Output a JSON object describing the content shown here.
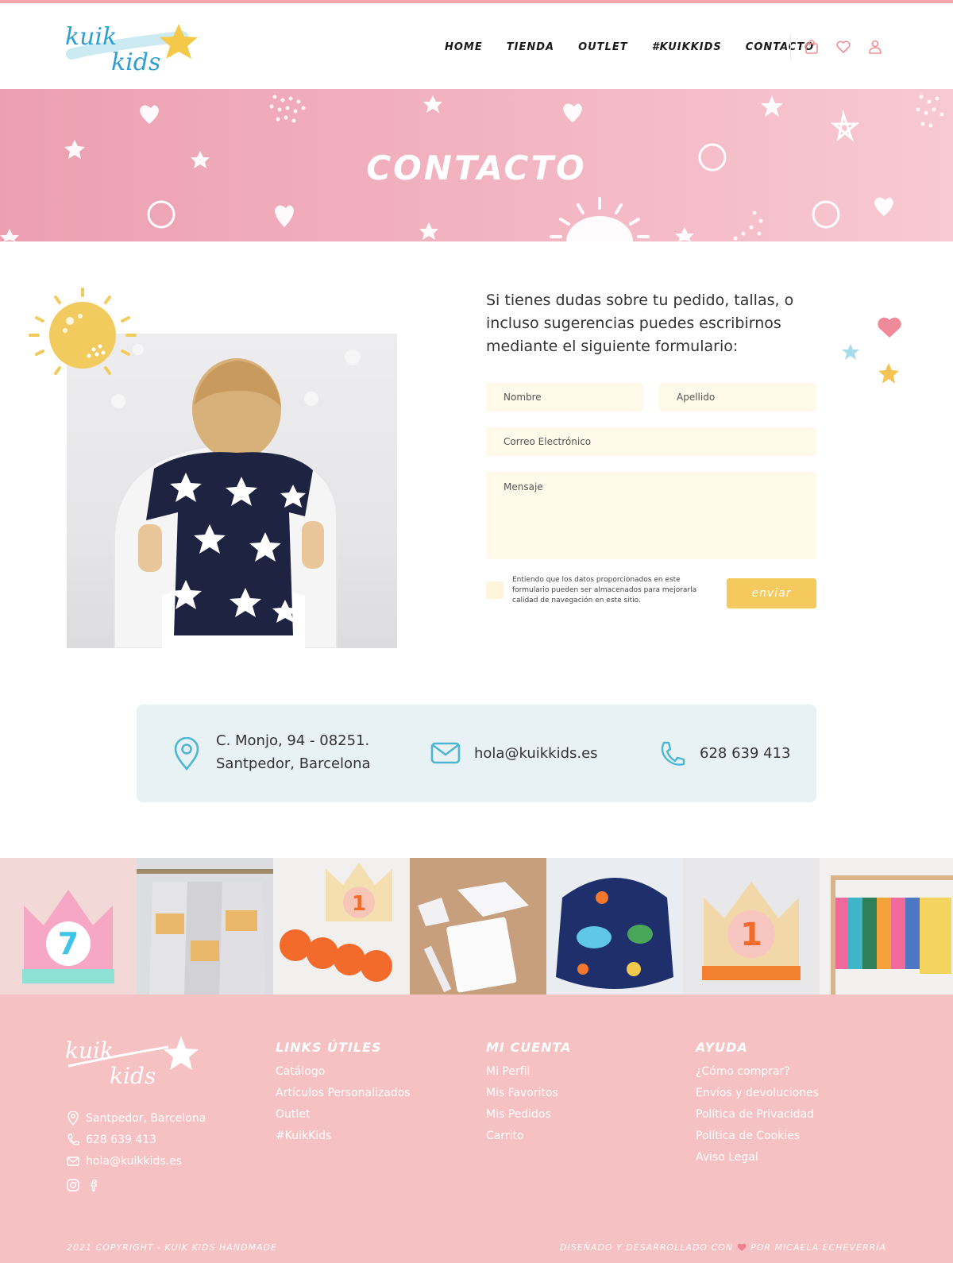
{
  "brand": {
    "logo_alt": "Kuik Kids",
    "accent_pink": "#f3a7ad",
    "accent_yellow": "#f4c95d",
    "accent_blue": "#4db6d2"
  },
  "nav": {
    "items": [
      {
        "label": "HOME"
      },
      {
        "label": "TIENDA"
      },
      {
        "label": "OUTLET"
      },
      {
        "label": "#KUIKKIDS"
      },
      {
        "label": "CONTACTO",
        "active": true
      }
    ],
    "icons": [
      "shopping-bag-icon",
      "heart-icon",
      "user-icon"
    ]
  },
  "banner": {
    "title": "CONTACTO"
  },
  "contact": {
    "intro": "Si tienes dudas sobre tu pedido, tallas, o incluso sugerencias puedes escribirnos mediante el siguiente formulario:",
    "form": {
      "first_name": {
        "placeholder": "Nombre",
        "value": ""
      },
      "last_name": {
        "placeholder": "Apellido",
        "value": ""
      },
      "email": {
        "placeholder": "Correo Electrónico",
        "value": ""
      },
      "message": {
        "placeholder": "Mensaje",
        "value": ""
      },
      "consent": "Entiendo que los datos proporcionados en este formulario pueden ser almacenados para  mejorarla calidad de navegación en este sitio.",
      "consent_checked": false,
      "submit_label": "enviar"
    }
  },
  "info": {
    "address_line1": "C. Monjo, 94 - 08251.",
    "address_line2": "Santpedor, Barcelona",
    "email": "hola@kuikkids.es",
    "phone": "628 639 413"
  },
  "gallery": {
    "tiles": [
      "crown-7",
      "aprons-names",
      "crown-1-numbers",
      "pouch-set",
      "sea-bib",
      "crown-1",
      "clothes-rack"
    ]
  },
  "footer": {
    "contact": {
      "location": "Santpedor, Barcelona",
      "phone": "628 639 413",
      "email": "hola@kuikkids.es"
    },
    "social": [
      "instagram-icon",
      "facebook-icon"
    ],
    "columns": [
      {
        "title": "LINKS ÚTILES",
        "links": [
          "Catálogo",
          "Artículos Personalizados",
          "Outlet",
          "#KuikKids"
        ]
      },
      {
        "title": "MI CUENTA",
        "links": [
          "Mi Perfil",
          "Mis Favoritos",
          "Mis Pedidos",
          "Carrito"
        ]
      },
      {
        "title": "AYUDA",
        "links": [
          "¿Cómo comprar?",
          "Envíos y devoluciones",
          "Política de Privacidad",
          "Política de Cookies",
          "Aviso Legal"
        ]
      }
    ],
    "copyright": "2021 COPYRIGHT - KUIK KIDS HANDMADE",
    "credits_prefix": "DISEÑADO Y DESARROLLADO CON",
    "credits_suffix": "POR MICAELA ECHEVERRÍA"
  }
}
